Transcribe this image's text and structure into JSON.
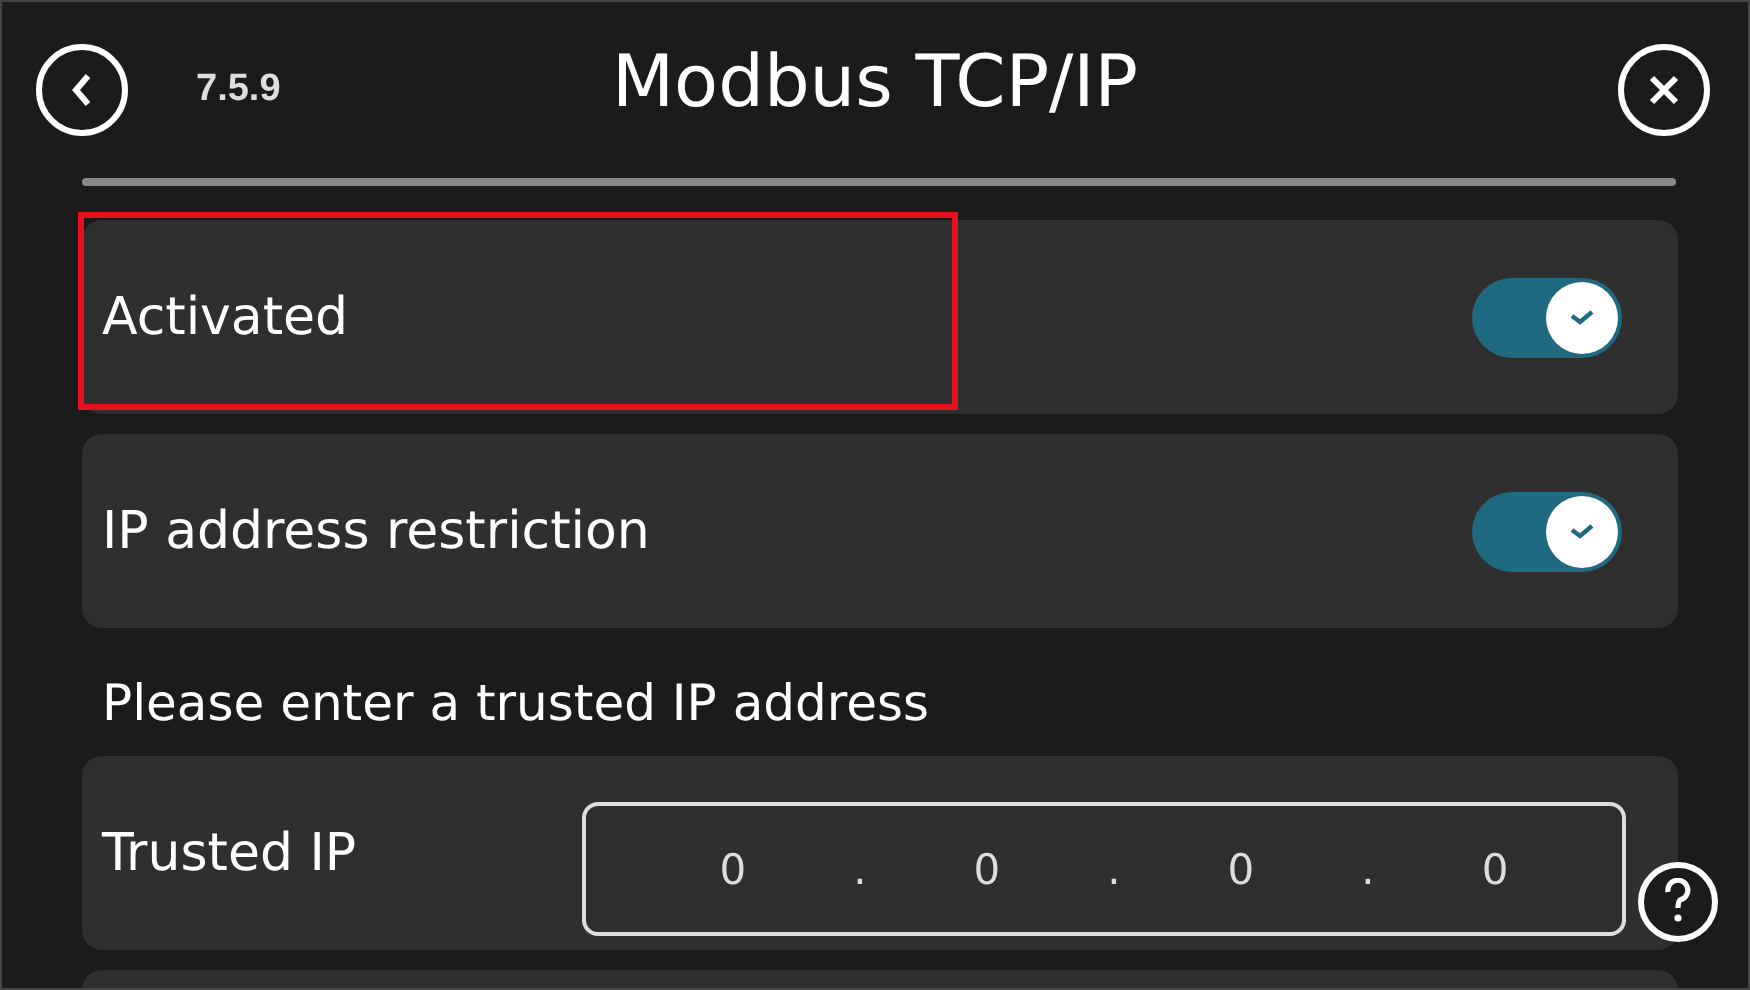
{
  "header": {
    "version": "7.5.9",
    "title": "Modbus TCP/IP"
  },
  "settings": [
    {
      "kind": "toggle",
      "label": "Activated",
      "on": true,
      "highlighted": true
    },
    {
      "kind": "toggle",
      "label": "IP address restriction",
      "on": true,
      "highlighted": false
    }
  ],
  "hint": "Please enter a trusted IP address",
  "trusted_ip": {
    "label": "Trusted IP",
    "separator": ".",
    "octets": [
      "0",
      "0",
      "0",
      "0"
    ]
  }
}
